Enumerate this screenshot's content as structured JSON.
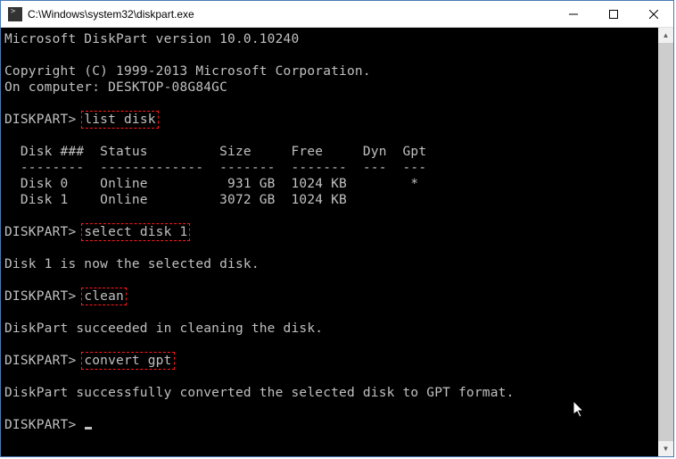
{
  "window": {
    "title": "C:\\Windows\\system32\\diskpart.exe"
  },
  "terminal": {
    "header_line": "Microsoft DiskPart version 10.0.10240",
    "copyright": "Copyright (C) 1999-2013 Microsoft Corporation.",
    "computer": "On computer: DESKTOP-08G84GC",
    "prompt": "DISKPART>",
    "cmd1": "list disk",
    "table_header": "  Disk ###  Status         Size     Free     Dyn  Gpt",
    "table_rule": "  --------  -------------  -------  -------  ---  ---",
    "row0": "  Disk 0    Online          931 GB  1024 KB        *",
    "row1": "  Disk 1    Online         3072 GB  1024 KB",
    "cmd2": "select disk 1",
    "msg_select": "Disk 1 is now the selected disk.",
    "cmd3": "clean",
    "msg_clean": "DiskPart succeeded in cleaning the disk.",
    "cmd4": "convert gpt",
    "msg_convert": "DiskPart successfully converted the selected disk to GPT format."
  },
  "disks": [
    {
      "id": "Disk 0",
      "status": "Online",
      "size": "931 GB",
      "free": "1024 KB",
      "dyn": "",
      "gpt": "*"
    },
    {
      "id": "Disk 1",
      "status": "Online",
      "size": "3072 GB",
      "free": "1024 KB",
      "dyn": "",
      "gpt": ""
    }
  ]
}
